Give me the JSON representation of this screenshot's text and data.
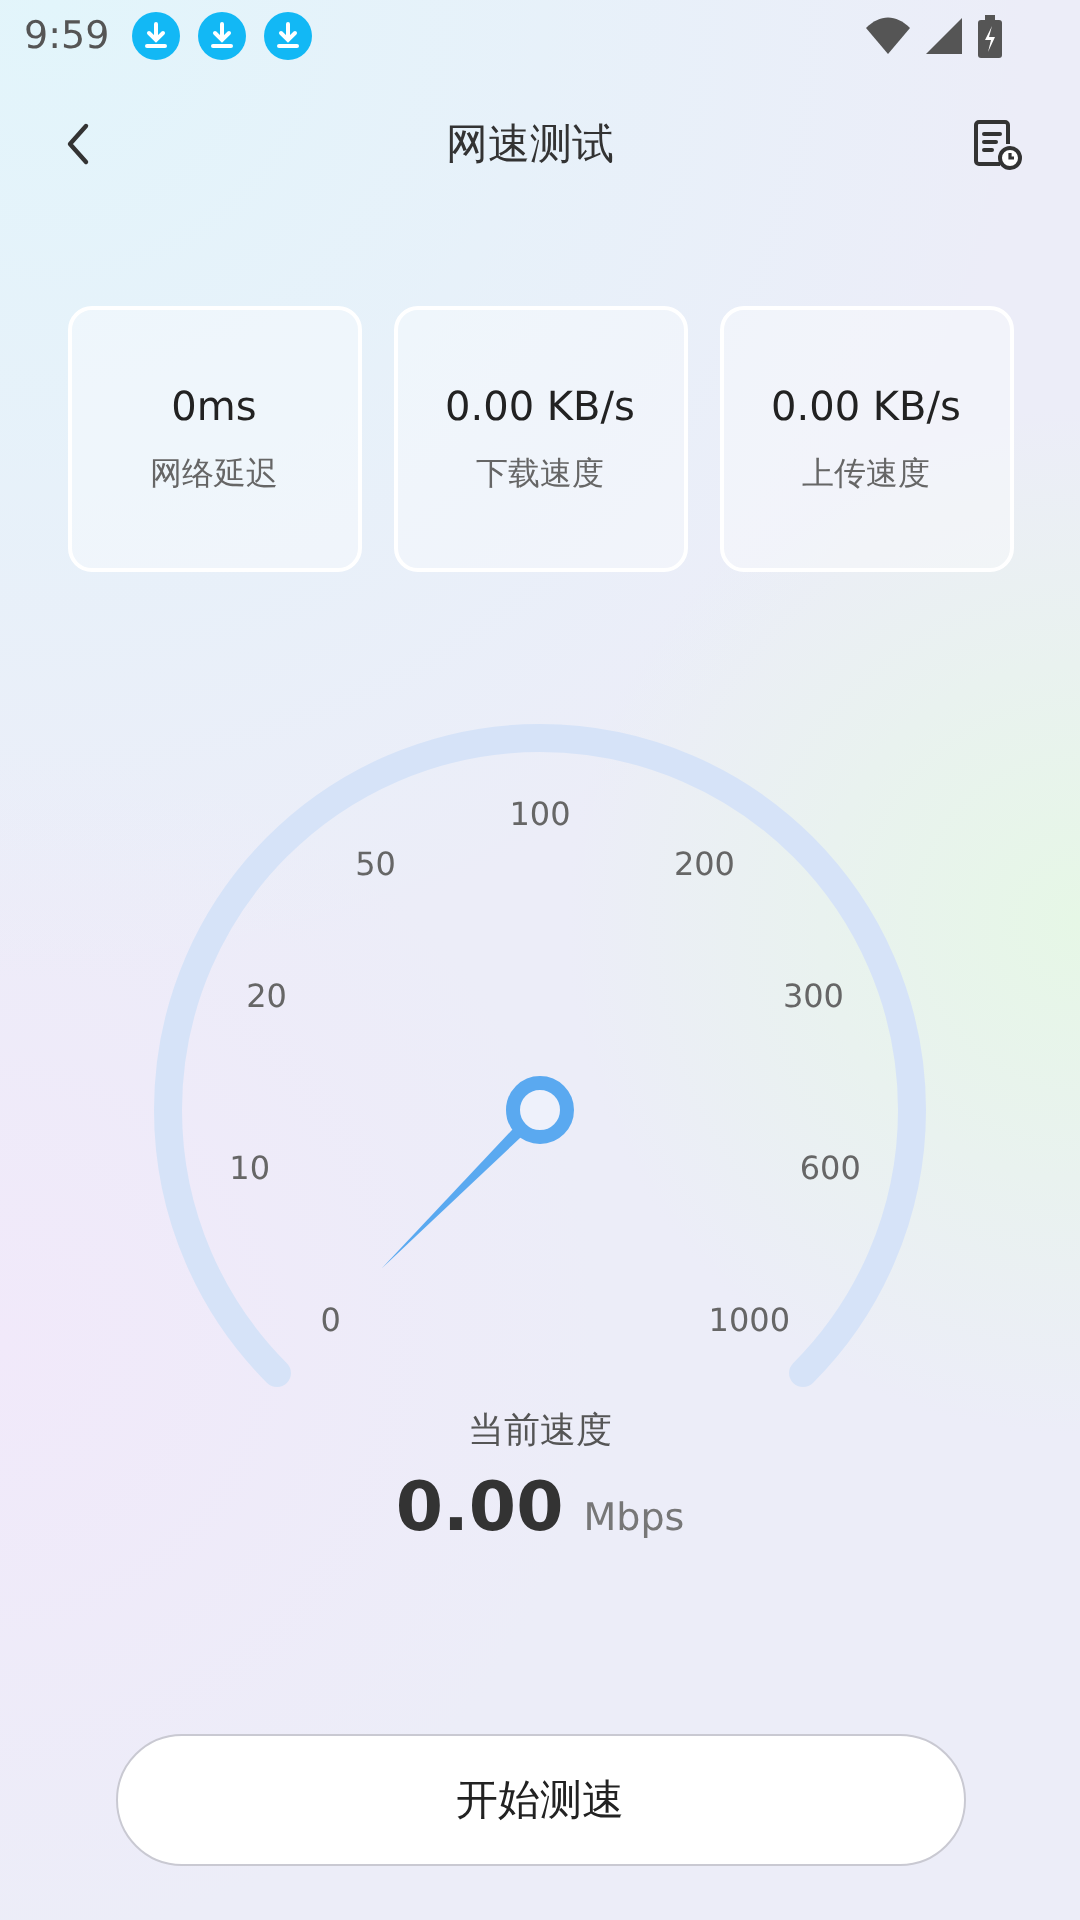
{
  "status_bar": {
    "time": "9:59",
    "notifications": [
      {
        "kind": "download"
      },
      {
        "kind": "download"
      },
      {
        "kind": "download"
      }
    ]
  },
  "header": {
    "title": "网速测试"
  },
  "stats": [
    {
      "value": "0ms",
      "label": "网络延迟"
    },
    {
      "value": "0.00 KB/s",
      "label": "下载速度"
    },
    {
      "value": "0.00 KB/s",
      "label": "上传速度"
    }
  ],
  "gauge": {
    "ticks": [
      "0",
      "10",
      "20",
      "50",
      "100",
      "200",
      "300",
      "600",
      "1000"
    ],
    "caption": "当前速度",
    "value": "0.00",
    "unit": "Mbps"
  },
  "start_button": "开始测速"
}
